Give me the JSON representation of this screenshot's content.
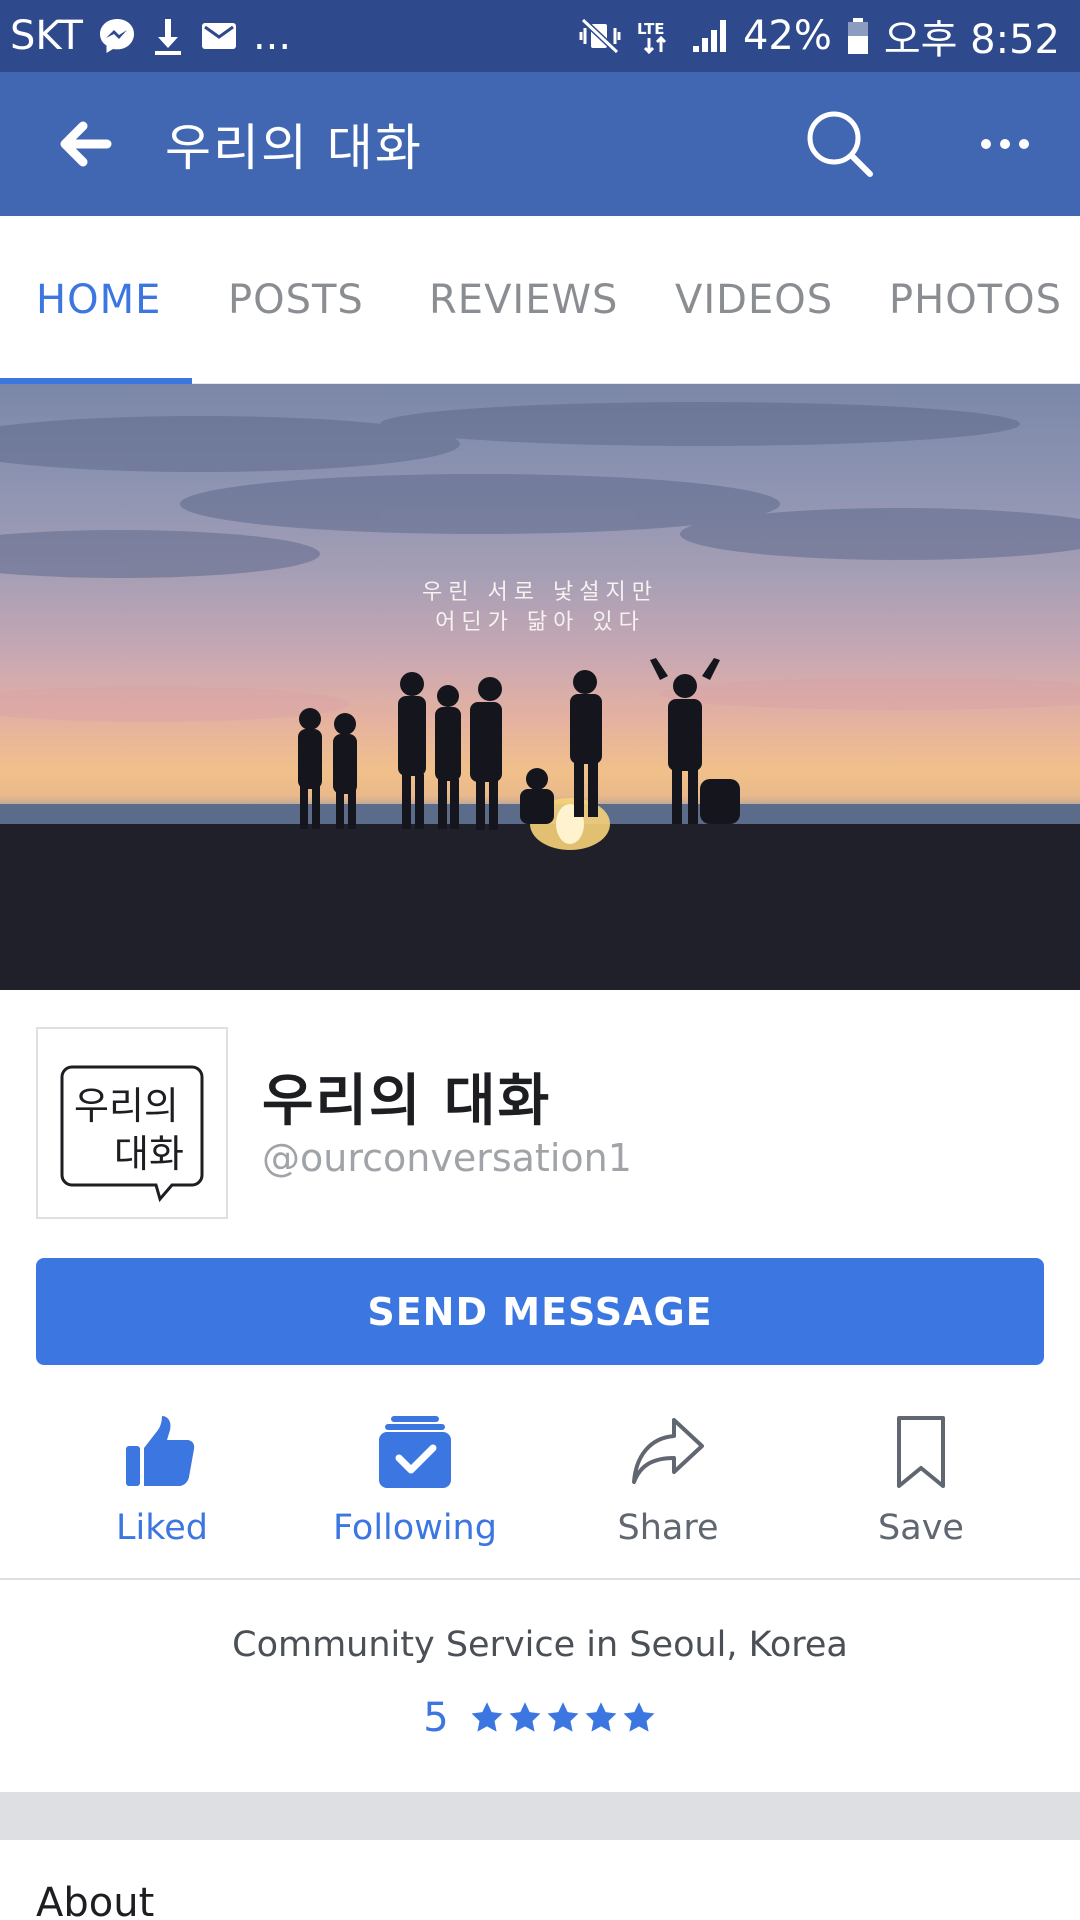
{
  "status_bar": {
    "carrier": "SKT",
    "more": "...",
    "network": "LTE",
    "battery": "42%",
    "time": "오후 8:52"
  },
  "app_bar": {
    "title": "우리의 대화"
  },
  "tabs": [
    {
      "label": "HOME",
      "active": true
    },
    {
      "label": "POSTS",
      "active": false
    },
    {
      "label": "REVIEWS",
      "active": false
    },
    {
      "label": "VIDEOS",
      "active": false
    },
    {
      "label": "PHOTOS",
      "active": false
    }
  ],
  "cover": {
    "caption_line1": "우린 서로 낯설지만",
    "caption_line2": "어딘가 닮아 있다"
  },
  "page": {
    "logo_line1": "우리의",
    "logo_line2": "대화",
    "name": "우리의 대화",
    "handle": "@ourconversation1"
  },
  "send_message_label": "SEND MESSAGE",
  "actions": [
    {
      "label": "Liked",
      "icon": "thumbs-up-icon"
    },
    {
      "label": "Following",
      "icon": "following-check-icon"
    },
    {
      "label": "Share",
      "icon": "share-arrow-icon"
    },
    {
      "label": "Save",
      "icon": "bookmark-icon"
    }
  ],
  "category": "Community Service in Seoul, Korea",
  "rating": {
    "value": "5",
    "stars": 5
  },
  "about_heading": "About",
  "colors": {
    "status_bar": "#2e4a8d",
    "app_bar": "#4267b2",
    "accent": "#3b76e1",
    "muted": "#8a8d91"
  }
}
